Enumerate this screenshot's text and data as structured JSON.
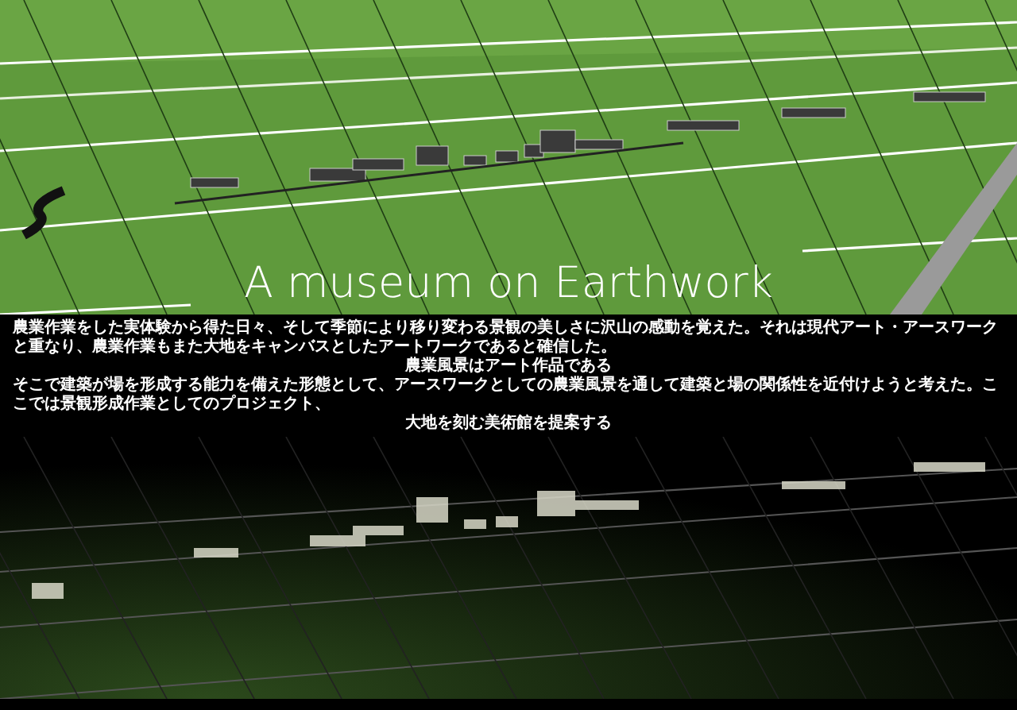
{
  "title": "A museum on Earthwork",
  "statement": [
    {
      "centered": false,
      "text": "農業作業をした実体験から得た日々、そして季節により移り変わる景観の美しさに沢山の感動を覚えた。それは現代アート・アースワークと重なり、農業作業もまた大地をキャンバスとしたアートワークであると確信した。"
    },
    {
      "centered": true,
      "text": "農業風景はアート作品である"
    },
    {
      "centered": false,
      "text": "そこで建築が場を形成する能力を備えた形態として、アースワークとしての農業風景を通して建築と場の関係性を近付けようと考えた。ここでは景観形成作業としてのプロジェクト、"
    },
    {
      "centered": true,
      "text": "大地を刻む美術館を提案する"
    }
  ]
}
